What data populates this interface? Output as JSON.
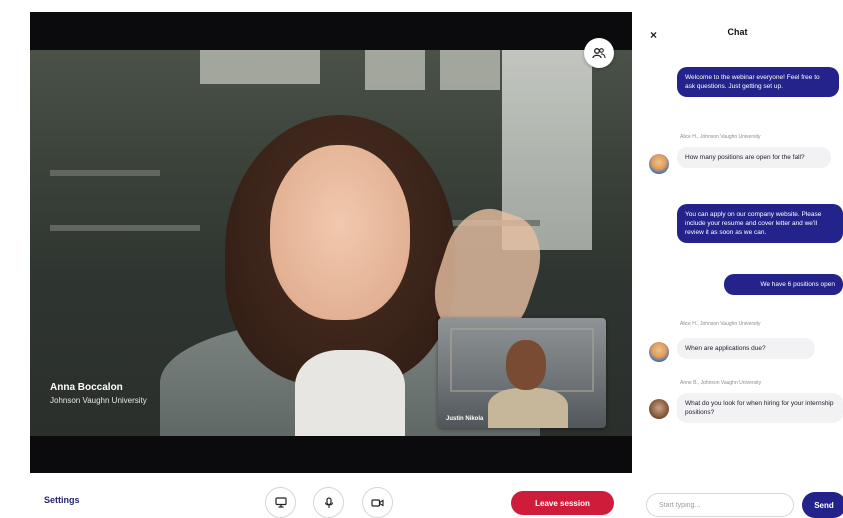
{
  "main_video": {
    "speaker_name": "Anna Boccalon",
    "speaker_org": "Johnson Vaughn University"
  },
  "self_view": {
    "name": "Justin Nikola"
  },
  "toolbar": {
    "settings_label": "Settings",
    "screen_share_icon": "monitor-icon",
    "mic_icon": "microphone-icon",
    "camera_icon": "video-camera-icon",
    "leave_label": "Leave session"
  },
  "chat": {
    "close_label": "×",
    "title": "Chat",
    "messages": [
      {
        "direction": "out",
        "text": "Welcome to the webinar everyone! Feel free to ask questions. Just getting set up."
      },
      {
        "direction": "in",
        "sender": "Alice H., Johnson Vaughn University",
        "text": "How many positions are open for the fall?"
      },
      {
        "direction": "out",
        "text": "You can apply on our company website. Please include your resume and cover letter and we'll review it as soon as we can."
      },
      {
        "direction": "out",
        "text": "We have 6 positions open"
      },
      {
        "direction": "in",
        "sender": "Alice H., Johnson Vaughn University",
        "text": "When are applications due?"
      },
      {
        "direction": "in",
        "sender": "Anne B., Johnson Vaughn University",
        "text": "What do you look for when hiring for your internship positions?"
      }
    ],
    "input_placeholder": "Start typing...",
    "send_label": "Send"
  },
  "colors": {
    "brand_navy": "#23238b",
    "leave_red": "#d01c3b"
  }
}
